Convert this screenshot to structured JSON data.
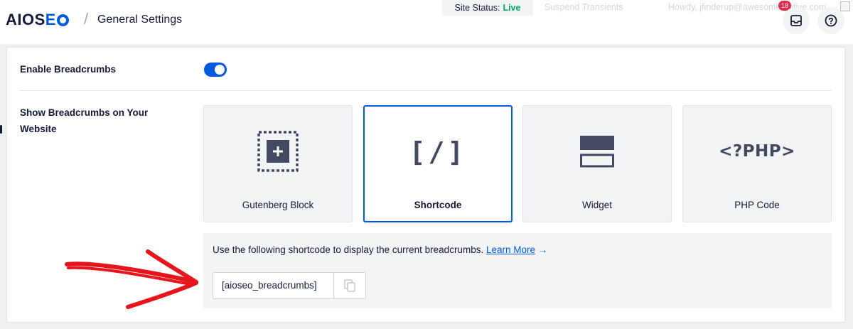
{
  "header": {
    "logo_main": "AIOS",
    "logo_accent": "E",
    "separator": "/",
    "title": "General Settings",
    "site_status_label": "Site Status:",
    "site_status_value": "Live",
    "suspend_link": "Suspend Transients",
    "howdy_text": "Howdy, jfinderup@awesomemotive.com",
    "notification_count": "18"
  },
  "settings": {
    "enable_breadcrumbs_label": "Enable Breadcrumbs",
    "enable_breadcrumbs_on": true,
    "show_breadcrumbs_label_line1": "Show Breadcrumbs on Your",
    "show_breadcrumbs_label_line2": "Website",
    "options": [
      {
        "label": "Gutenberg Block",
        "icon": "gutenberg-block-icon",
        "selected": false
      },
      {
        "label": "Shortcode",
        "icon": "shortcode-icon",
        "icon_text": "[/]",
        "selected": true
      },
      {
        "label": "Widget",
        "icon": "widget-icon",
        "selected": false
      },
      {
        "label": "PHP Code",
        "icon": "php-code-icon",
        "icon_text": "<?PHP>",
        "selected": false
      }
    ],
    "info_text": "Use the following shortcode to display the current breadcrumbs.",
    "learn_more": "Learn More",
    "learn_more_arrow": "→",
    "shortcode_value": "[aioseo_breadcrumbs]"
  },
  "colors": {
    "accent": "#005ae0",
    "live": "#00aa63",
    "annotation_arrow": "#e8141c"
  }
}
